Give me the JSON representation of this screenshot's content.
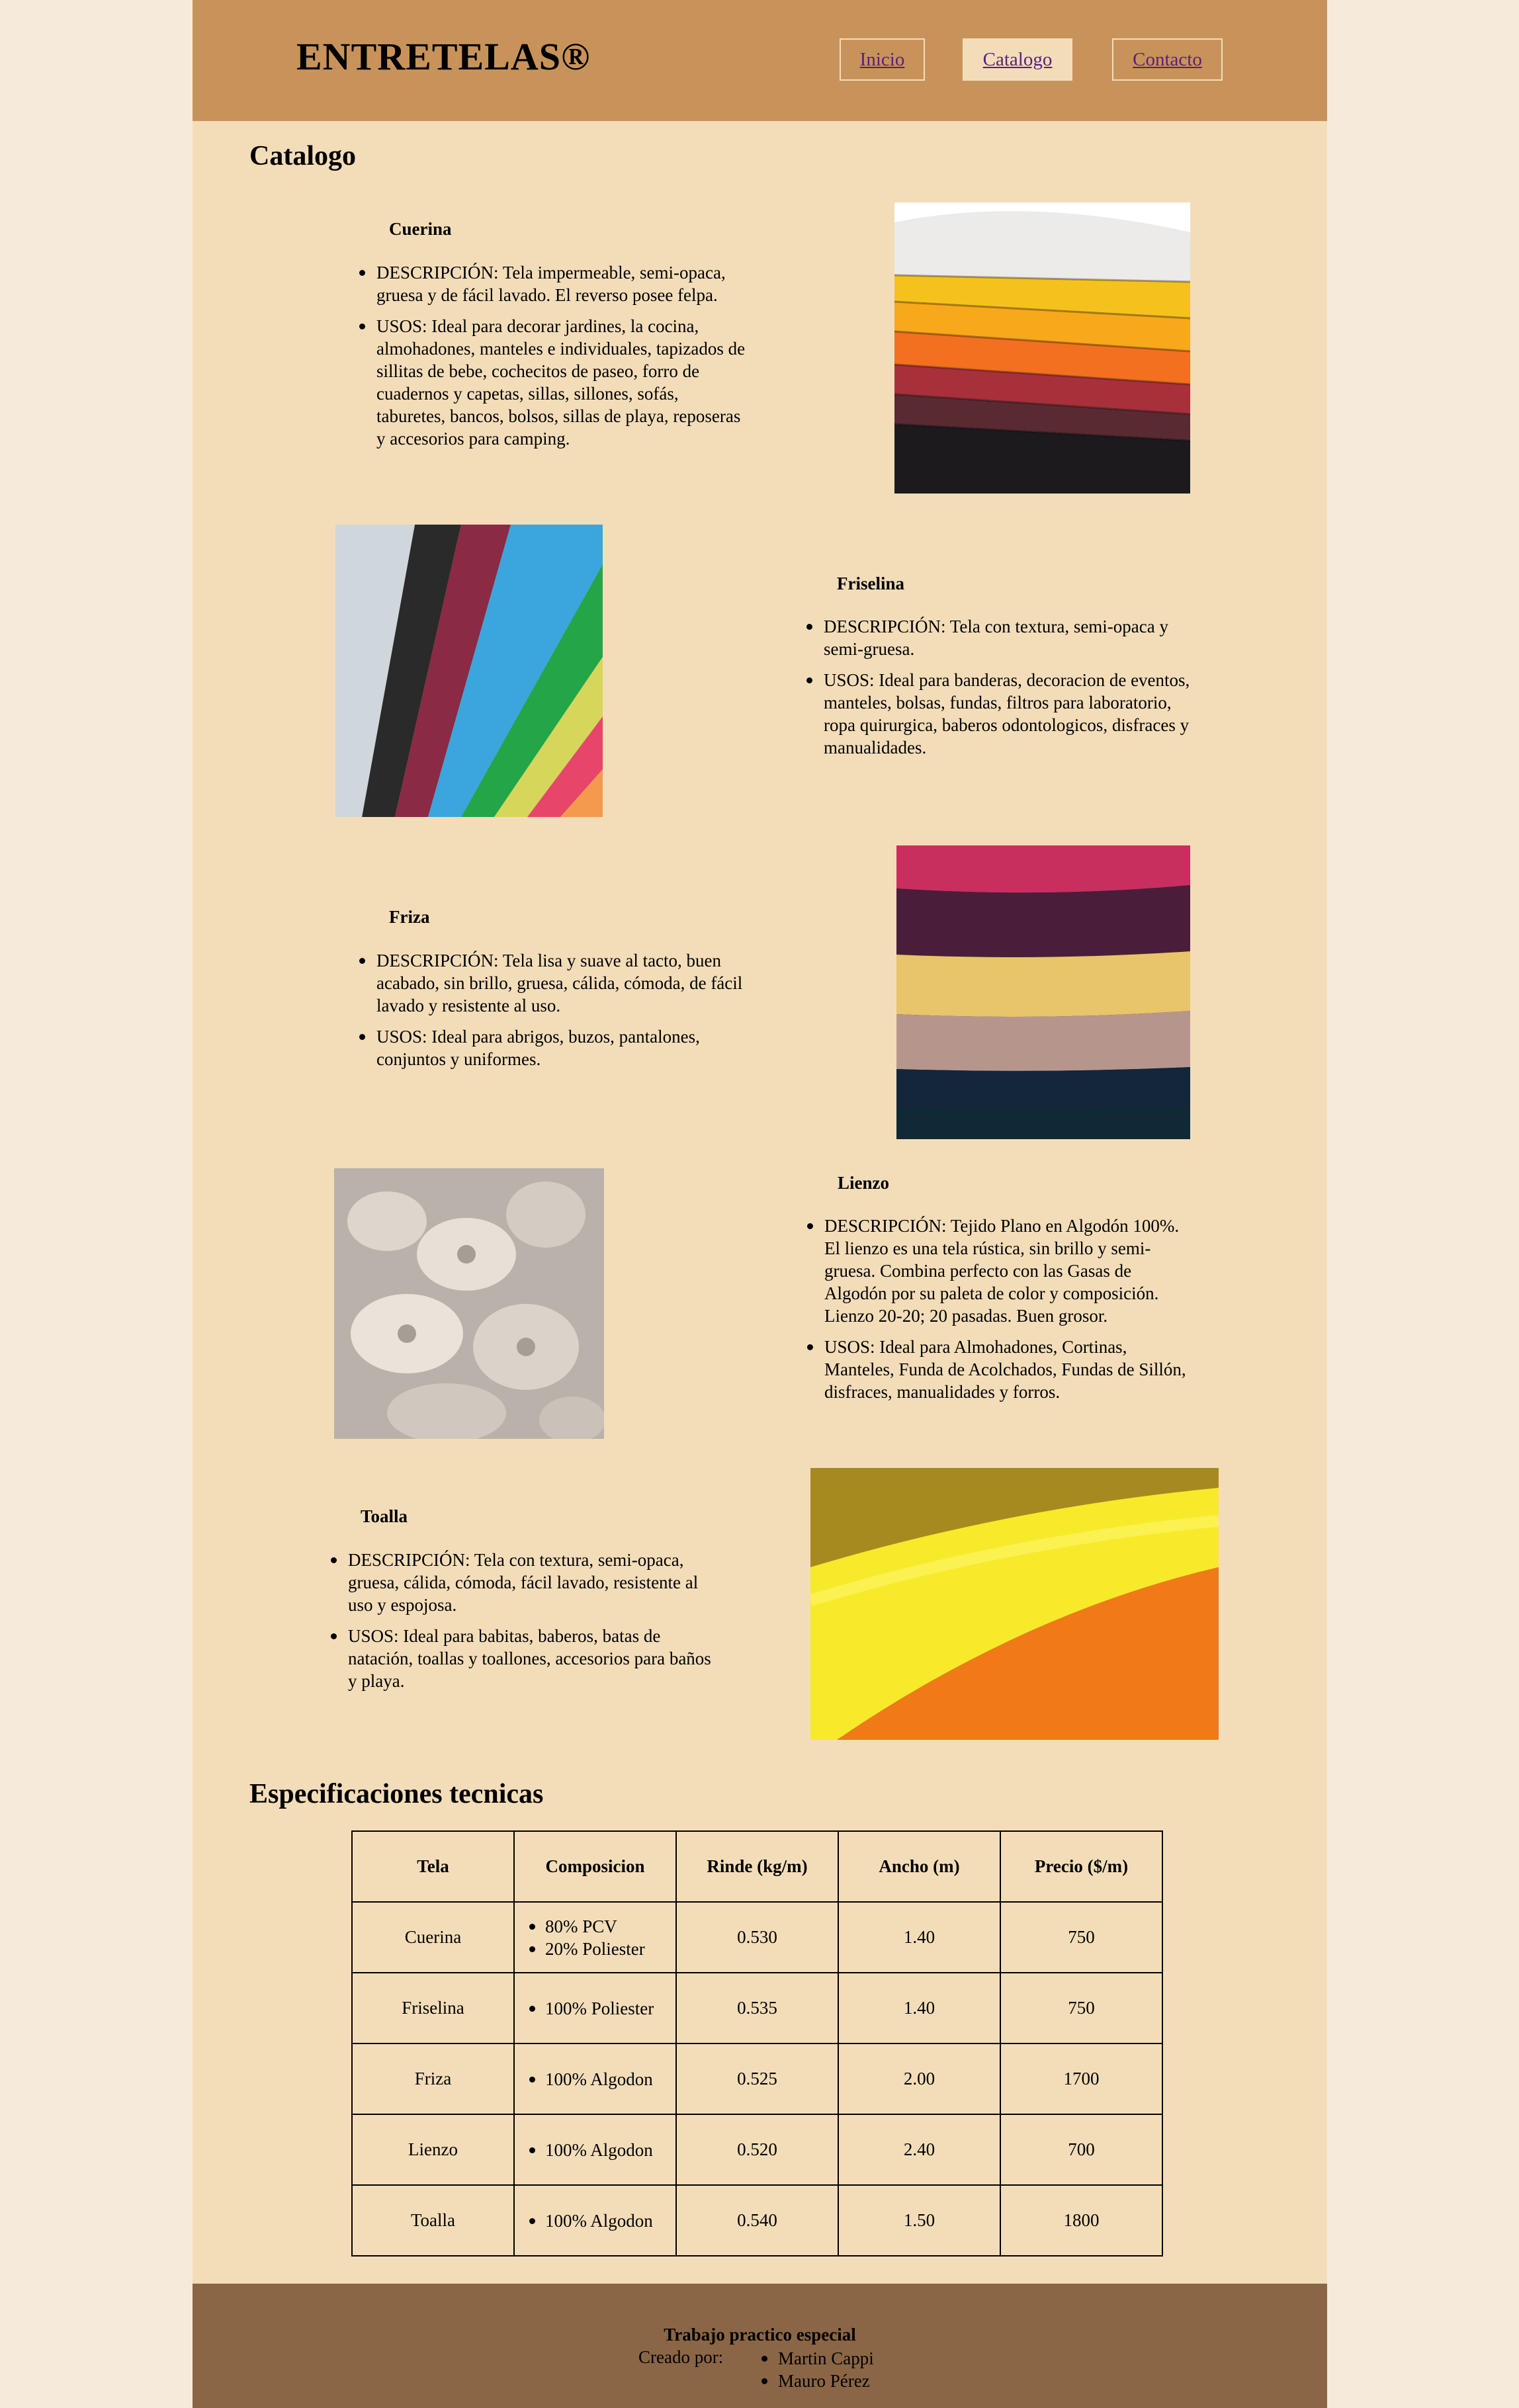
{
  "header": {
    "brand": "ENTRETELAS®",
    "nav": [
      {
        "label": "Inicio",
        "active": false
      },
      {
        "label": "Catalogo",
        "active": true
      },
      {
        "label": "Contacto",
        "active": false
      }
    ]
  },
  "catalog": {
    "heading": "Catalogo",
    "products": [
      {
        "title": "Cuerina",
        "description": "DESCRIPCIÓN: Tela impermeable, semi-opaca, gruesa y de fácil lavado. El reverso posee felpa.",
        "uses": "USOS: Ideal para decorar jardines, la cocina, almohadones, manteles e individuales, tapizados de sillitas de bebe, cochecitos de paseo, forro de cuadernos y capetas, sillas, sillones, sofás, taburetes, bancos, bolsos, sillas de playa, reposeras y accesorios para camping."
      },
      {
        "title": "Friselina",
        "description": "DESCRIPCIÓN: Tela con textura, semi-opaca y semi-gruesa.",
        "uses": "USOS: Ideal para banderas, decoracion de eventos, manteles, bolsas, fundas, filtros para laboratorio, ropa quirurgica, baberos odontologicos, disfraces y manualidades."
      },
      {
        "title": "Friza",
        "description": "DESCRIPCIÓN: Tela lisa y suave al tacto, buen acabado, sin brillo, gruesa, cálida, cómoda, de fácil lavado y resistente al uso.",
        "uses": "USOS: Ideal para abrigos, buzos, pantalones, conjuntos y uniformes."
      },
      {
        "title": "Lienzo",
        "description": "DESCRIPCIÓN: Tejido Plano en Algodón 100%. El lienzo es una tela rústica, sin brillo y semi-gruesa. Combina perfecto con las Gasas de Algodón por su paleta de color y composición. Lienzo 20-20; 20 pasadas. Buen grosor.",
        "uses": "USOS: Ideal para Almohadones, Cortinas, Manteles, Funda de Acolchados, Fundas de Sillón, disfraces, manualidades y forros."
      },
      {
        "title": "Toalla",
        "description": "DESCRIPCIÓN: Tela con textura, semi-opaca, gruesa, cálida, cómoda, fácil lavado, resistente al uso y espojosa.",
        "uses": "USOS: Ideal para babitas, baberos, batas de natación, toallas y toallones, accesorios para baños y playa."
      }
    ]
  },
  "specs": {
    "heading": "Especificaciones tecnicas",
    "columns": [
      "Tela",
      "Composicion",
      "Rinde (kg/m)",
      "Ancho (m)",
      "Precio ($/m)"
    ],
    "rows": [
      {
        "tela": "Cuerina",
        "composicion": [
          "80% PCV",
          "20% Poliester"
        ],
        "rinde": "0.530",
        "ancho": "1.40",
        "precio": "750"
      },
      {
        "tela": "Friselina",
        "composicion": [
          "100% Poliester"
        ],
        "rinde": "0.535",
        "ancho": "1.40",
        "precio": "750"
      },
      {
        "tela": "Friza",
        "composicion": [
          "100% Algodon"
        ],
        "rinde": "0.525",
        "ancho": "2.00",
        "precio": "1700"
      },
      {
        "tela": "Lienzo",
        "composicion": [
          "100% Algodon"
        ],
        "rinde": "0.520",
        "ancho": "2.40",
        "precio": "700"
      },
      {
        "tela": "Toalla",
        "composicion": [
          "100% Algodon"
        ],
        "rinde": "0.540",
        "ancho": "1.50",
        "precio": "1800"
      }
    ]
  },
  "footer": {
    "title": "Trabajo practico especial",
    "created_by": "Creado por:",
    "authors": [
      "Martin Cappi",
      "Mauro Pérez"
    ]
  },
  "colors": {
    "outer_background": "#f6ebda",
    "page_background": "#f3ddb9",
    "header_background": "#c8935a",
    "footer_background": "#8a6646",
    "link": "#5a1f7a"
  }
}
